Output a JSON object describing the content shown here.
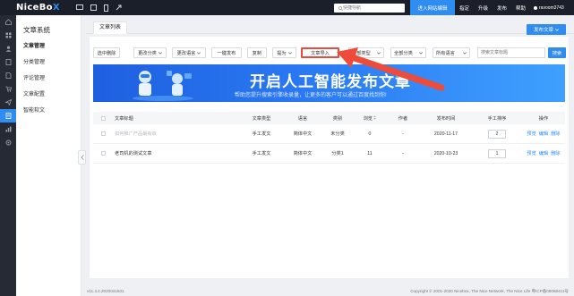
{
  "topbar": {
    "logo_main": "NiceBo",
    "logo_x": "X",
    "search_placeholder": "快捷导航",
    "primary_button": "进入网站编辑",
    "nav": [
      "指定",
      "升级",
      "发布",
      "帮助"
    ],
    "username": "ravoom3743"
  },
  "rail": {
    "icons": [
      "home-icon",
      "grid-icon",
      "user-icon",
      "document-icon",
      "file-icon",
      "cart-icon",
      "send-icon",
      "chart-icon",
      "settings-icon"
    ],
    "active_index": 3
  },
  "sidebar": {
    "title": "文章系统",
    "items": [
      "文章管理",
      "分类管理",
      "评论管理",
      "文章配置",
      "智能软文"
    ],
    "active_index": 0
  },
  "main": {
    "tab": "文章列表",
    "publish_button": "发布文章"
  },
  "toolbar": {
    "buttons": [
      "选中删除",
      "更改分类",
      "更改语言",
      "一键发布",
      "复制",
      "提为",
      "文章导入"
    ],
    "selects": [
      "全部类型",
      "全部分类",
      "所有语言"
    ],
    "search_placeholder": "搜索文章标题",
    "search_button": "搜索"
  },
  "banner": {
    "headline": "开启人工智能发布文章",
    "subtitle": "帮助您提升搜索引擎收录量，让更多的客户可以通过百度找到你!"
  },
  "table": {
    "headers": [
      "文章标题",
      "文章类型",
      "语言",
      "类别",
      "浏览",
      "作者",
      "发布时间",
      "手工排序",
      "操作"
    ],
    "rows": [
      {
        "title": "如何推广产品最有效",
        "type": "手工发文",
        "lang": "简体中文",
        "cat": "未分类",
        "views": "0",
        "author": "-",
        "time": "2020-11-17",
        "sort": "2",
        "ops": [
          "预览",
          "编辑",
          "删除"
        ],
        "muted": true
      },
      {
        "title": "老司机的测试文章",
        "type": "手工发文",
        "lang": "简体中文",
        "cat": "分类1",
        "views": "11",
        "author": "-",
        "time": "2020-10-23",
        "sort": "1",
        "ops": [
          "预览",
          "编辑",
          "删除"
        ],
        "muted": false
      }
    ]
  },
  "footer": {
    "version": "v11.3.2.2020041501",
    "copyright": "Copyright © 2001-2020 Nicebox, The Nice Network, The Nice Life  粤ICP备05068411号"
  },
  "colors": {
    "accent": "#2f8cf0",
    "topbar": "#1b1f2a",
    "highlight": "#e74c3c"
  }
}
